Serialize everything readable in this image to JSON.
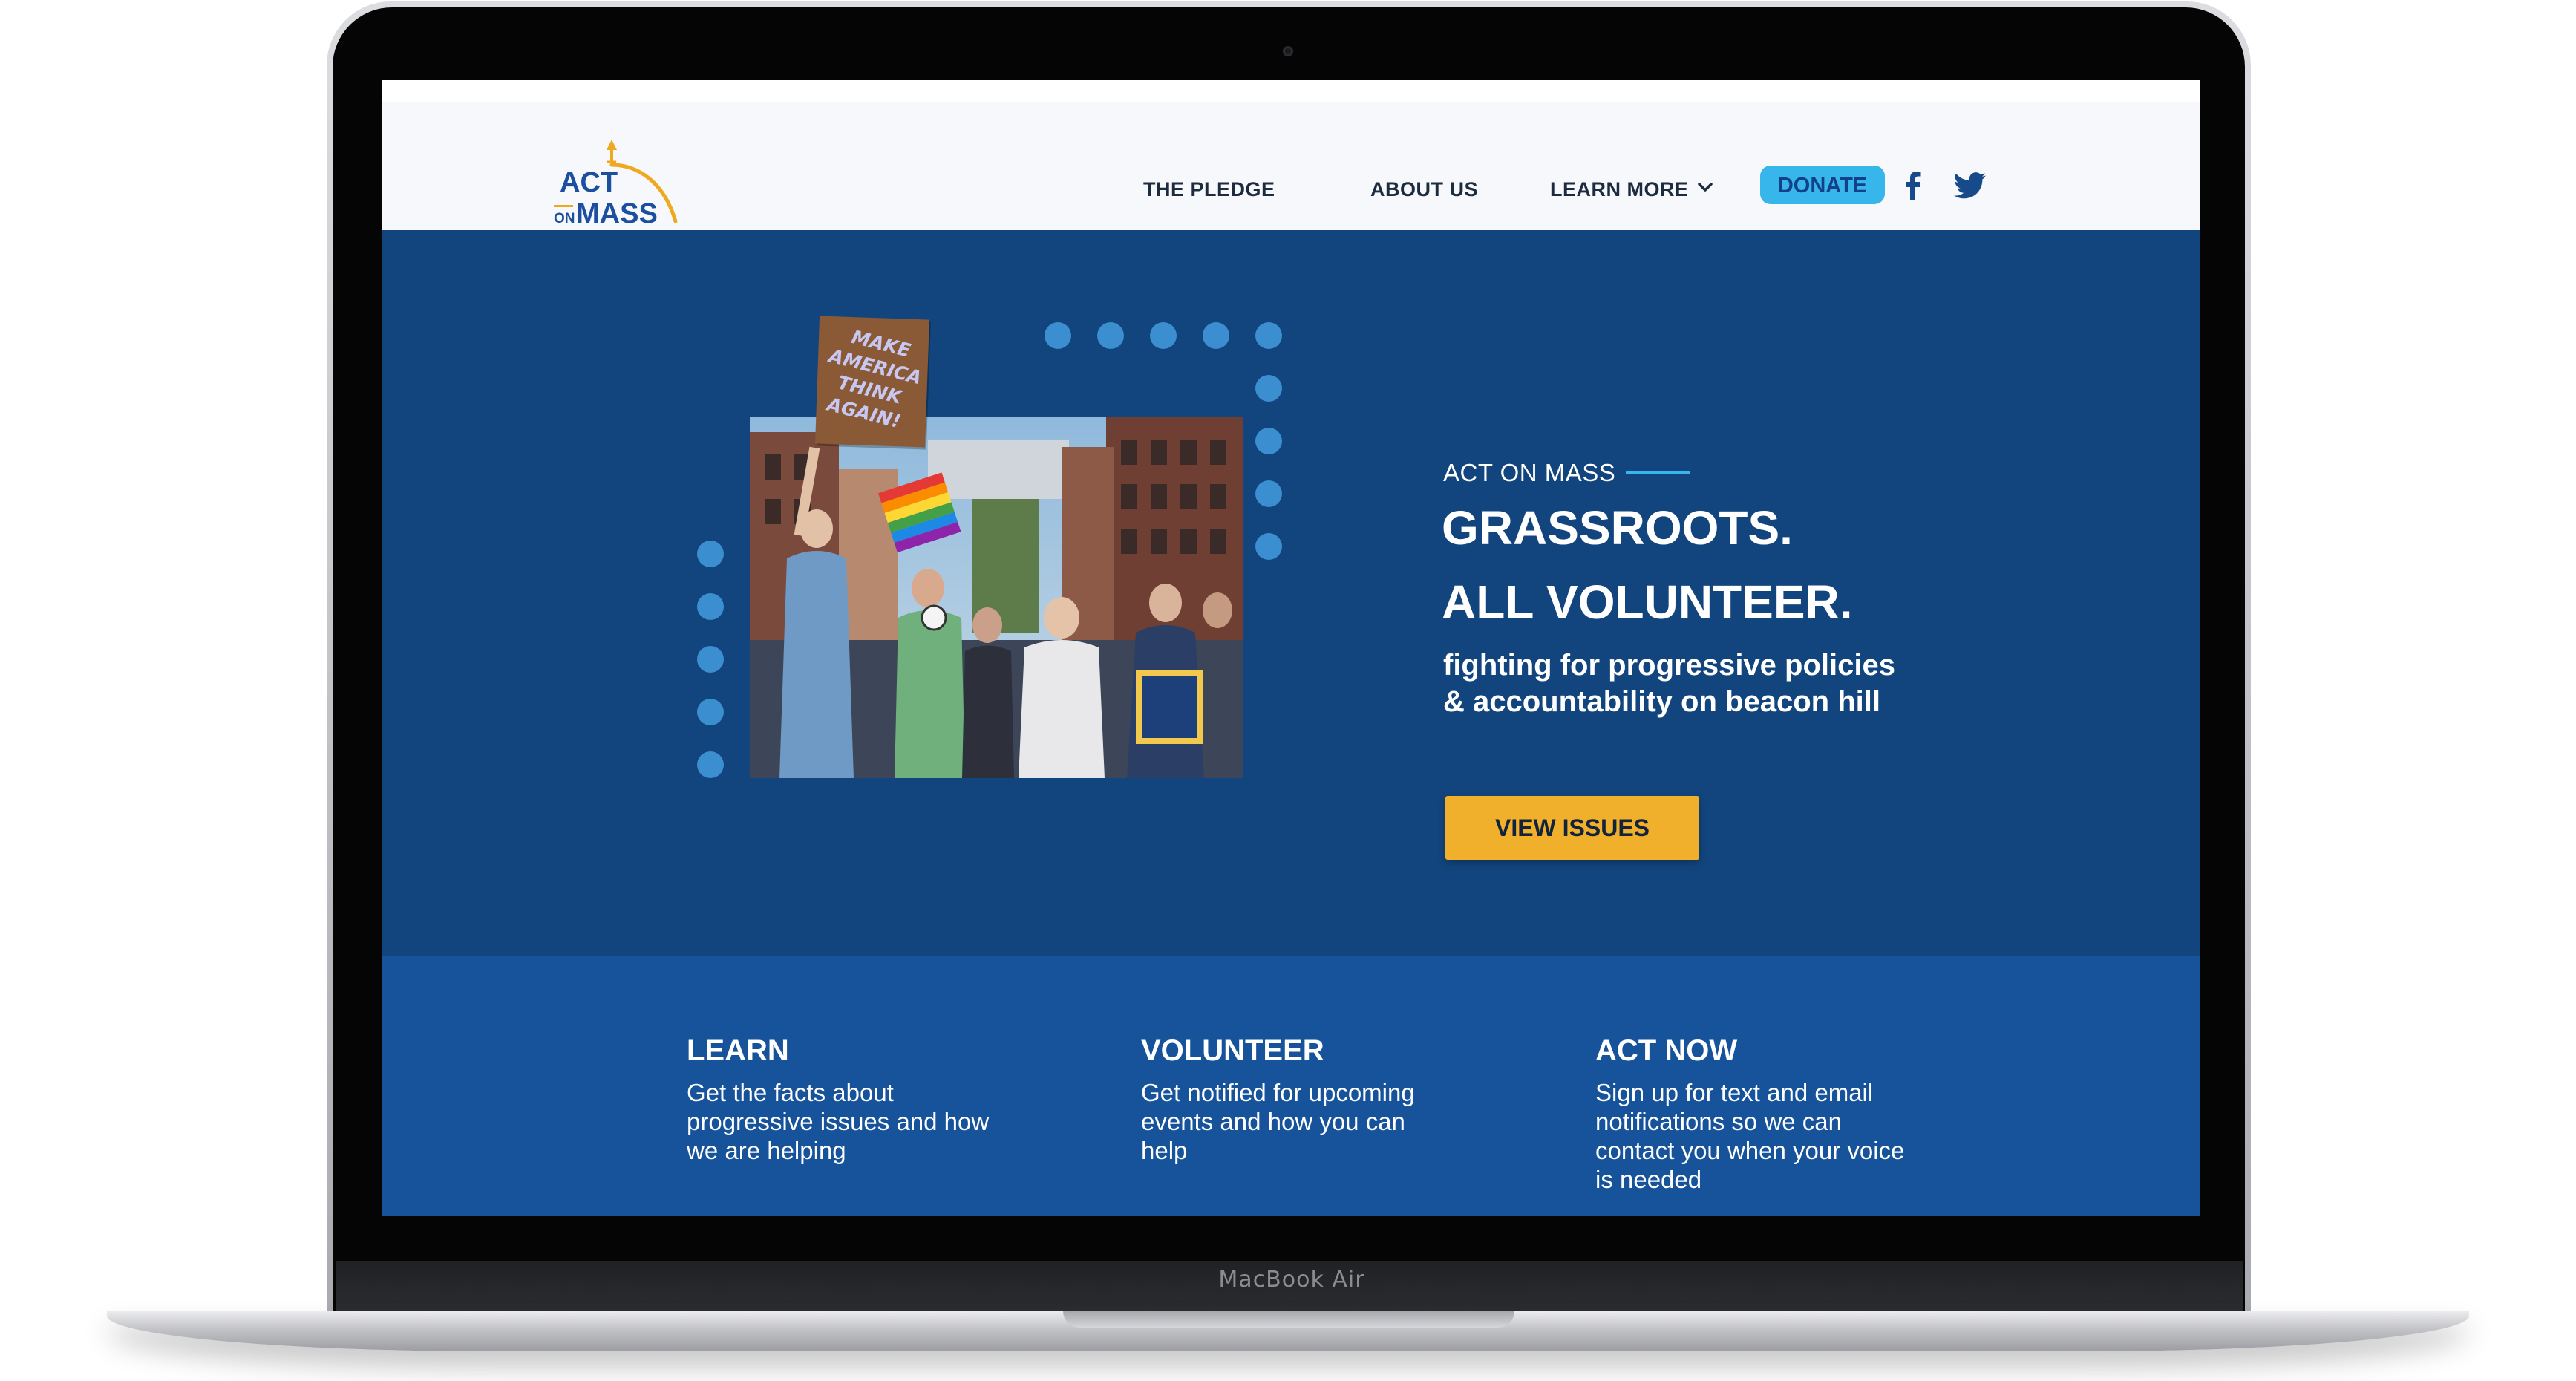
{
  "device": {
    "label": "MacBook Air"
  },
  "site": {
    "logo": {
      "line1": "ACT",
      "line2_small": "ON",
      "line2_big": "MASS",
      "colors": {
        "text": "#1c4fa0",
        "accent": "#f0a81f"
      }
    },
    "nav": {
      "pledge": "THE PLEDGE",
      "about": "ABOUT US",
      "learn_more": "LEARN MORE",
      "learn_more_icon": "chevron-down",
      "donate": "DONATE",
      "social": [
        "facebook",
        "twitter"
      ]
    },
    "hero": {
      "sign_text": "MAKE AMERICA THINK AGAIN!",
      "eyebrow": "ACT ON MASS",
      "title_line1": "GRASSROOTS.",
      "title_line2": "ALL VOLUNTEER.",
      "subtitle": "fighting for progressive policies & accountability on beacon hill",
      "cta": "VIEW ISSUES"
    },
    "features": [
      {
        "title": "LEARN",
        "body": "Get the facts about progressive issues and how we are helping"
      },
      {
        "title": "VOLUNTEER",
        "body": "Get notified for upcoming events and how you can help"
      },
      {
        "title": "ACT NOW",
        "body": "Sign up for text and email notifications so we can contact you when your voice is needed"
      }
    ],
    "colors": {
      "header_bg": "#f6f8fb",
      "hero_bg": "#12457d",
      "features_bg": "#16539a",
      "accent_blue": "#36b6ea",
      "cta_yellow": "#f0b02b",
      "dot_blue": "#3b8ed0"
    }
  }
}
